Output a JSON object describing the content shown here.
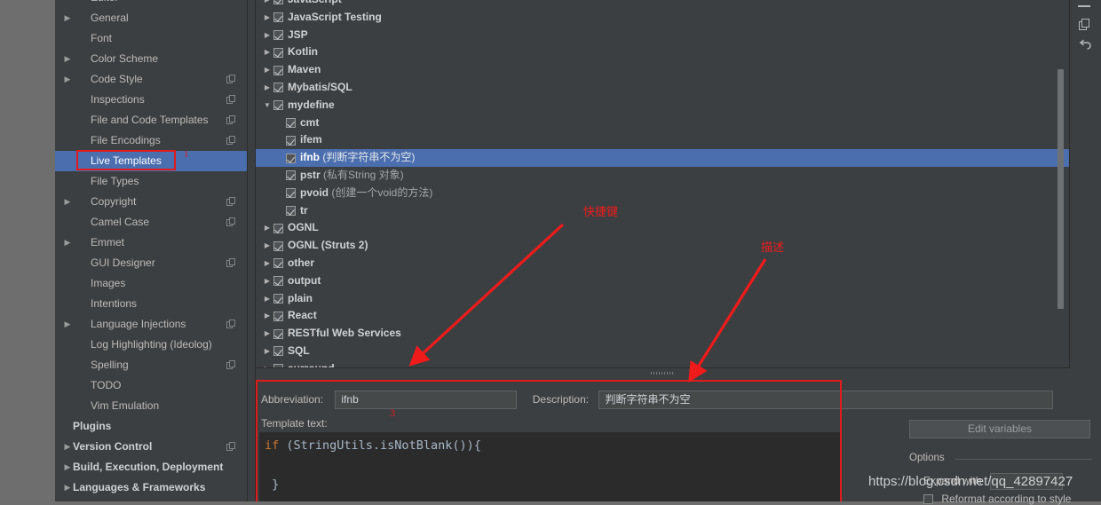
{
  "settings_tree": {
    "items": [
      {
        "label": "Editor",
        "arrow": "down",
        "bold": false,
        "copy": false,
        "cut_top": true,
        "selected": false
      },
      {
        "label": "General",
        "arrow": "right",
        "bold": false,
        "copy": false,
        "selected": false
      },
      {
        "label": "Font",
        "arrow": "none",
        "bold": false,
        "copy": false,
        "selected": false
      },
      {
        "label": "Color Scheme",
        "arrow": "right",
        "bold": false,
        "copy": false,
        "selected": false
      },
      {
        "label": "Code Style",
        "arrow": "right",
        "bold": false,
        "copy": true,
        "selected": false
      },
      {
        "label": "Inspections",
        "arrow": "none",
        "bold": false,
        "copy": true,
        "selected": false
      },
      {
        "label": "File and Code Templates",
        "arrow": "none",
        "bold": false,
        "copy": true,
        "selected": false
      },
      {
        "label": "File Encodings",
        "arrow": "none",
        "bold": false,
        "copy": true,
        "selected": false
      },
      {
        "label": "Live Templates",
        "arrow": "none",
        "bold": false,
        "copy": false,
        "selected": true
      },
      {
        "label": "File Types",
        "arrow": "none",
        "bold": false,
        "copy": false,
        "selected": false
      },
      {
        "label": "Copyright",
        "arrow": "right",
        "bold": false,
        "copy": true,
        "selected": false
      },
      {
        "label": "Camel Case",
        "arrow": "none",
        "bold": false,
        "copy": true,
        "selected": false
      },
      {
        "label": "Emmet",
        "arrow": "right",
        "bold": false,
        "copy": false,
        "selected": false
      },
      {
        "label": "GUI Designer",
        "arrow": "none",
        "bold": false,
        "copy": true,
        "selected": false
      },
      {
        "label": "Images",
        "arrow": "none",
        "bold": false,
        "copy": false,
        "selected": false
      },
      {
        "label": "Intentions",
        "arrow": "none",
        "bold": false,
        "copy": false,
        "selected": false
      },
      {
        "label": "Language Injections",
        "arrow": "right",
        "bold": false,
        "copy": true,
        "selected": false
      },
      {
        "label": "Log Highlighting (Ideolog)",
        "arrow": "none",
        "bold": false,
        "copy": false,
        "selected": false
      },
      {
        "label": "Spelling",
        "arrow": "none",
        "bold": false,
        "copy": true,
        "selected": false
      },
      {
        "label": "TODO",
        "arrow": "none",
        "bold": false,
        "copy": false,
        "selected": false
      },
      {
        "label": "Vim Emulation",
        "arrow": "none",
        "bold": false,
        "copy": false,
        "selected": false
      },
      {
        "label": "Plugins",
        "arrow": "none",
        "bold": true,
        "copy": false,
        "selected": false,
        "root": true
      },
      {
        "label": "Version Control",
        "arrow": "right",
        "bold": true,
        "copy": true,
        "selected": false,
        "root": true
      },
      {
        "label": "Build, Execution, Deployment",
        "arrow": "right",
        "bold": true,
        "copy": false,
        "selected": false,
        "root": true
      },
      {
        "label": "Languages & Frameworks",
        "arrow": "right",
        "bold": true,
        "copy": false,
        "selected": false,
        "root": true
      }
    ]
  },
  "template_tree": {
    "rows": [
      {
        "name": "JavaScript",
        "desc": "",
        "arrow": "right",
        "checked": true,
        "level": 0,
        "selected": false
      },
      {
        "name": "JavaScript Testing",
        "desc": "",
        "arrow": "right",
        "checked": true,
        "level": 0,
        "selected": false
      },
      {
        "name": "JSP",
        "desc": "",
        "arrow": "right",
        "checked": true,
        "level": 0,
        "selected": false
      },
      {
        "name": "Kotlin",
        "desc": "",
        "arrow": "right",
        "checked": true,
        "level": 0,
        "selected": false
      },
      {
        "name": "Maven",
        "desc": "",
        "arrow": "right",
        "checked": true,
        "level": 0,
        "selected": false
      },
      {
        "name": "Mybatis/SQL",
        "desc": "",
        "arrow": "right",
        "checked": true,
        "level": 0,
        "selected": false
      },
      {
        "name": "mydefine",
        "desc": "",
        "arrow": "down",
        "checked": true,
        "level": 0,
        "selected": false
      },
      {
        "name": "cmt",
        "desc": "",
        "arrow": "none",
        "checked": true,
        "level": 1,
        "selected": false
      },
      {
        "name": "ifem",
        "desc": "",
        "arrow": "none",
        "checked": true,
        "level": 1,
        "selected": false
      },
      {
        "name": "ifnb",
        "desc": " (判断字符串不为空)",
        "arrow": "none",
        "checked": true,
        "level": 1,
        "selected": true
      },
      {
        "name": "pstr",
        "desc": " (私有String 对象)",
        "arrow": "none",
        "checked": true,
        "level": 1,
        "selected": false
      },
      {
        "name": "pvoid",
        "desc": " (创建一个void的方法)",
        "arrow": "none",
        "checked": true,
        "level": 1,
        "selected": false
      },
      {
        "name": "tr",
        "desc": "",
        "arrow": "none",
        "checked": true,
        "level": 1,
        "selected": false
      },
      {
        "name": "OGNL",
        "desc": "",
        "arrow": "right",
        "checked": true,
        "level": 0,
        "selected": false
      },
      {
        "name": "OGNL (Struts 2)",
        "desc": "",
        "arrow": "right",
        "checked": true,
        "level": 0,
        "selected": false
      },
      {
        "name": "other",
        "desc": "",
        "arrow": "right",
        "checked": true,
        "level": 0,
        "selected": false
      },
      {
        "name": "output",
        "desc": "",
        "arrow": "right",
        "checked": true,
        "level": 0,
        "selected": false
      },
      {
        "name": "plain",
        "desc": "",
        "arrow": "right",
        "checked": true,
        "level": 0,
        "selected": false
      },
      {
        "name": "React",
        "desc": "",
        "arrow": "right",
        "checked": true,
        "level": 0,
        "selected": false
      },
      {
        "name": "RESTful Web Services",
        "desc": "",
        "arrow": "right",
        "checked": true,
        "level": 0,
        "selected": false
      },
      {
        "name": "SQL",
        "desc": "",
        "arrow": "right",
        "checked": true,
        "level": 0,
        "selected": false
      },
      {
        "name": "surround",
        "desc": "",
        "arrow": "right",
        "checked": true,
        "level": 0,
        "selected": false
      }
    ]
  },
  "toolbar": {
    "remove_icon": "minus-icon",
    "duplicate_icon": "copy-icon",
    "revert_icon": "undo-icon"
  },
  "editor": {
    "abbreviation_label": "Abbreviation:",
    "abbreviation_value": "ifnb",
    "description_label": "Description:",
    "description_value": "判断字符串不为空",
    "template_text_label": "Template text:",
    "code_lines": [
      {
        "kw": "if",
        "rest": " (StringUtils.isNotBlank()){"
      },
      {
        "kw": "",
        "rest": ""
      },
      {
        "kw": "",
        "rest": " }"
      }
    ]
  },
  "options": {
    "edit_variables_label": "Edit variables",
    "title": "Options",
    "expand_with_label": "Expand with",
    "expand_with_value": "",
    "reformat_label": "Reformat according to style"
  },
  "annotations": {
    "marker_1": "1",
    "marker_3": "3",
    "label_shortcut": "快捷键",
    "label_description": "描述",
    "accent_red": "#ef1b1b"
  },
  "watermark": {
    "text": "https://blog.csdn.net/qq_42897427"
  }
}
